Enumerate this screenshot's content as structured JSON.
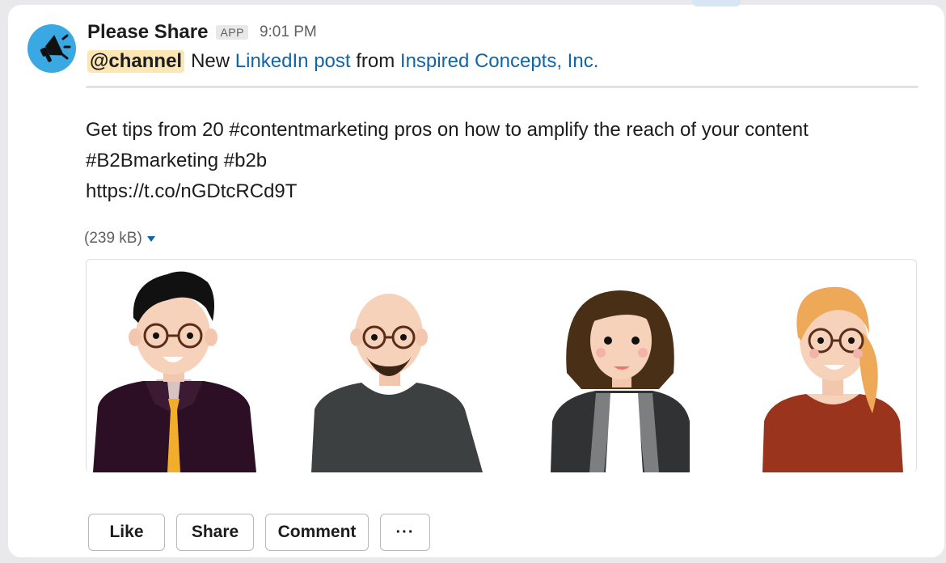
{
  "message": {
    "sender": "Please Share",
    "badge": "APP",
    "time": "9:01 PM",
    "intro": {
      "mention": "@channel",
      "text1": "New",
      "link1": "LinkedIn post",
      "text2": "from",
      "link2": "Inspired Concepts, Inc."
    },
    "post_lines": [
      "Get tips from 20 #contentmarketing pros on how to amplify the reach of your content",
      "#B2Bmarketing #b2b",
      "https://t.co/nGDtcRCd9T"
    ],
    "file_size": "(239 kB)"
  },
  "actions": {
    "like": "Like",
    "share": "Share",
    "comment": "Comment",
    "more": "···"
  },
  "icons": {
    "avatar": "megaphone-icon",
    "file_toggle": "caret-down-icon"
  },
  "colors": {
    "link": "#1264a3",
    "mention_bg": "#fbe6b4",
    "avatar_bg": "#3aa9e3"
  }
}
